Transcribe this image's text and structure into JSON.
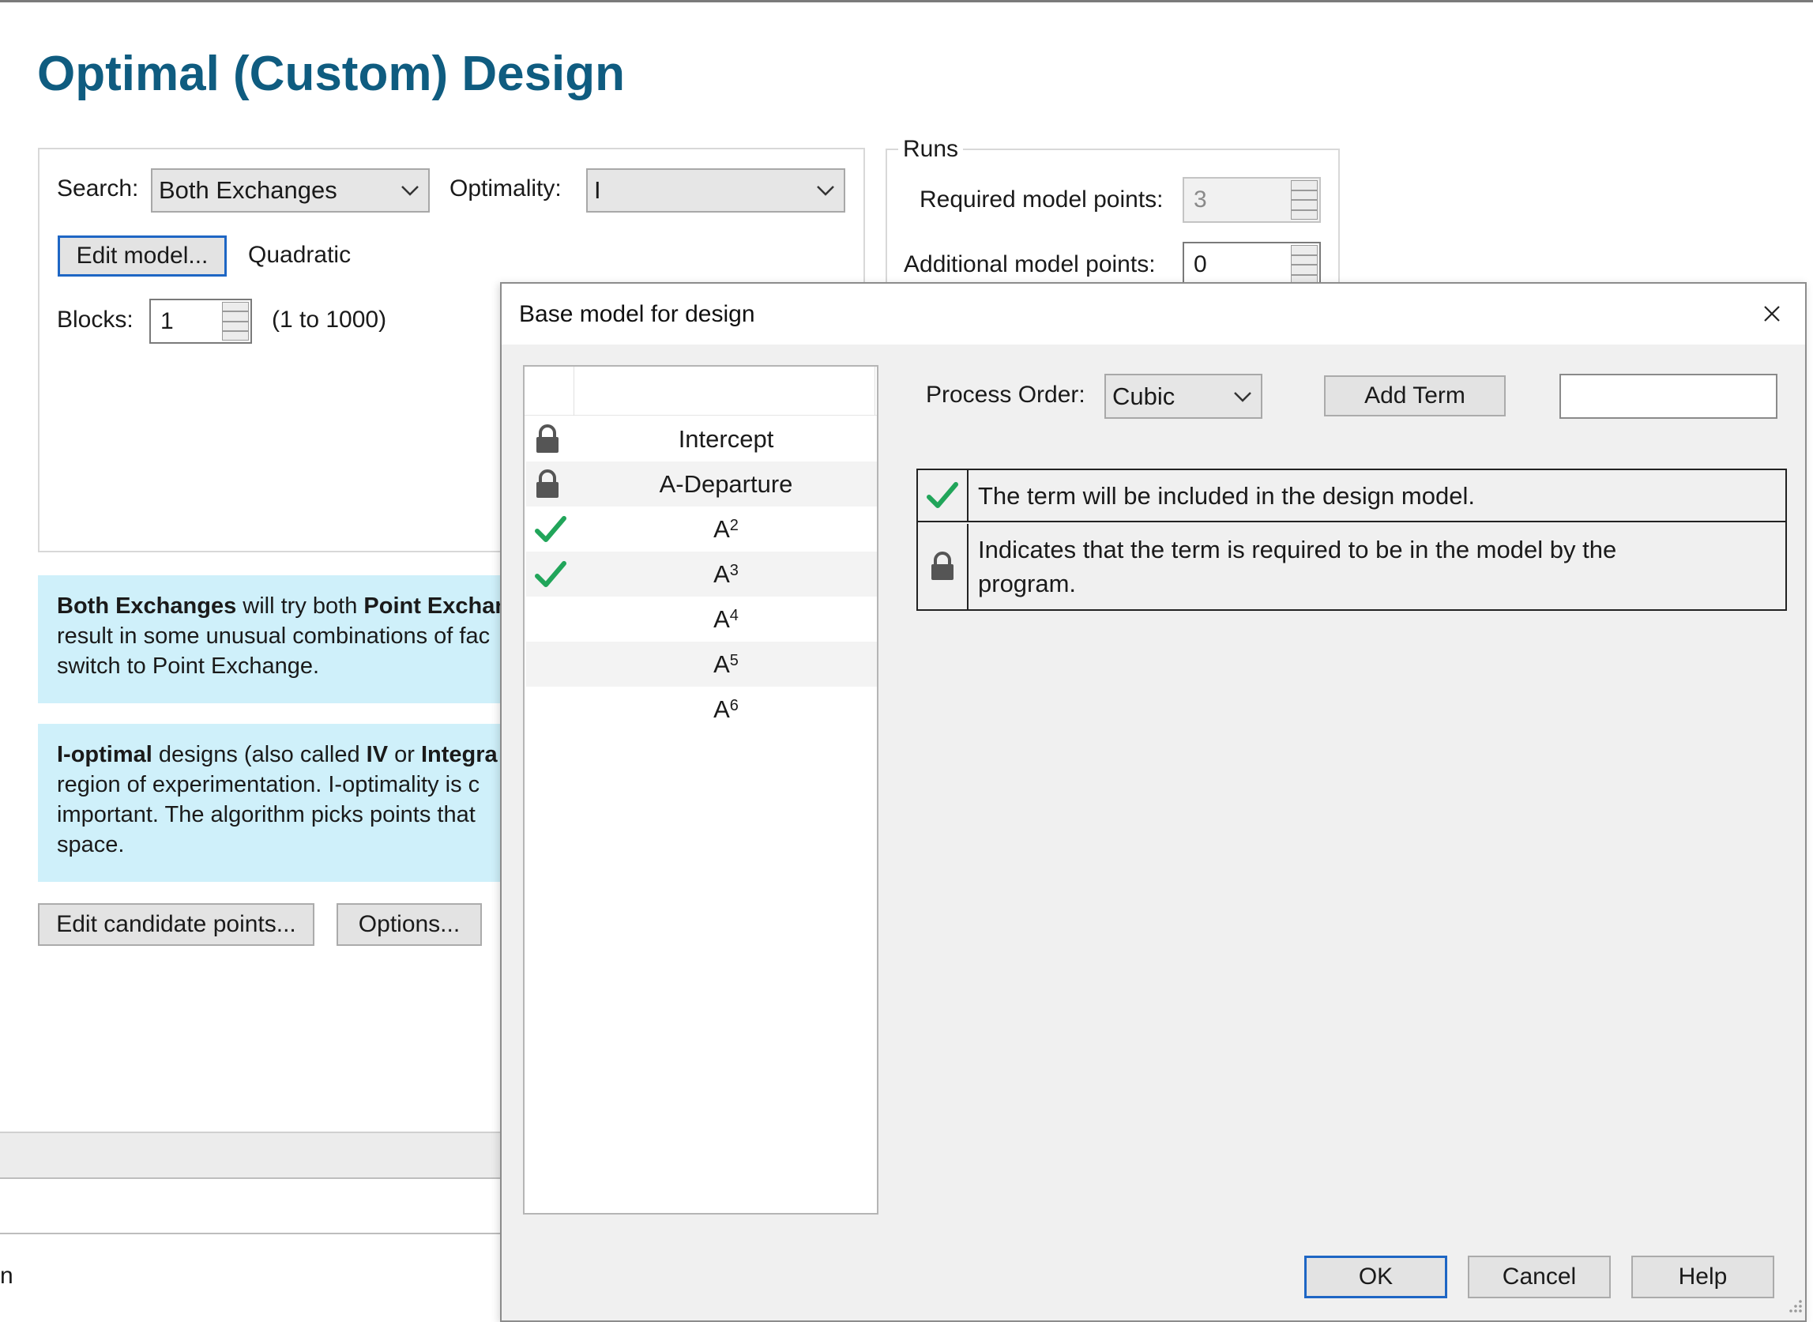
{
  "page": {
    "title": "Optimal (Custom) Design"
  },
  "settings": {
    "search_label": "Search:",
    "search_value": "Both Exchanges",
    "optimality_label": "Optimality:",
    "optimality_value": "I",
    "edit_model_label": "Edit model...",
    "model_name": "Quadratic",
    "blocks_label": "Blocks:",
    "blocks_value": "1",
    "blocks_range": "(1 to 1000)"
  },
  "runs": {
    "legend": "Runs",
    "required_label": "Required model points:",
    "required_value": "3",
    "additional_label": "Additional model points:",
    "additional_value": "0"
  },
  "info1": {
    "bold1": "Both Exchanges",
    "text1": " will try both ",
    "bold2": "Point Exchan",
    "line2": "result in some unusual combinations of fac",
    "line3": "switch to Point Exchange."
  },
  "info2": {
    "bold1": "I-optimal",
    "text1": " designs (also called ",
    "bold2": "IV",
    "text2": " or ",
    "bold3": "Integra",
    "line2": "region of experimentation. I-optimality is c",
    "line3": "important. The algorithm picks points that",
    "line4": "space."
  },
  "buttons": {
    "edit_candidate_label": "Edit candidate points...",
    "options_label": "Options..."
  },
  "bottom": {
    "partial_text": "n"
  },
  "dialog": {
    "title": "Base model for design",
    "process_order_label": "Process Order:",
    "process_order_value": "Cubic",
    "add_term_label": "Add Term",
    "add_term_input_value": "",
    "terms": [
      {
        "base": "Intercept",
        "exp": "",
        "icon": "lock-icon"
      },
      {
        "base": "A-Departure",
        "exp": "",
        "icon": "lock-icon"
      },
      {
        "base": "A",
        "exp": "2",
        "icon": "checkmark-icon"
      },
      {
        "base": "A",
        "exp": "3",
        "icon": "checkmark-icon"
      },
      {
        "base": "A",
        "exp": "4",
        "icon": ""
      },
      {
        "base": "A",
        "exp": "5",
        "icon": ""
      },
      {
        "base": "A",
        "exp": "6",
        "icon": ""
      }
    ],
    "legend_included": "The term will be included in the design model.",
    "legend_required_line1": "Indicates that the term is required to be in the model by the",
    "legend_required_line2": "program.",
    "ok_label": "OK",
    "cancel_label": "Cancel",
    "help_label": "Help"
  },
  "colors": {
    "title": "#0f5c80",
    "info_bg": "#cff0fa",
    "check_green": "#21a55a",
    "focus_blue": "#1e66c4"
  }
}
